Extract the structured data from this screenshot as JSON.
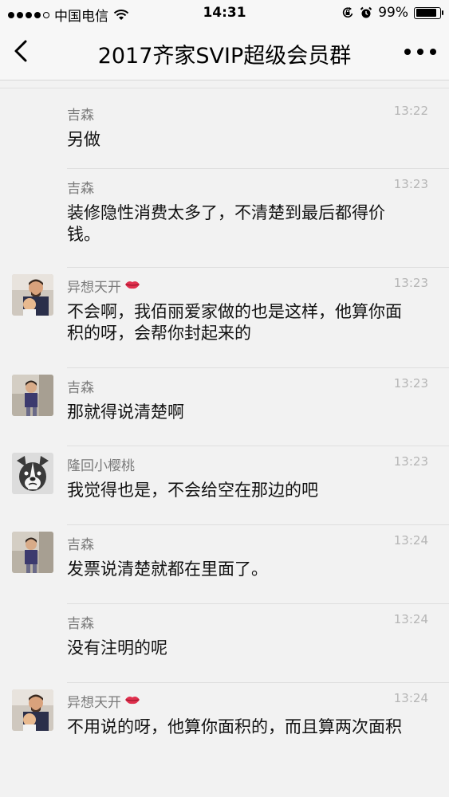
{
  "status_bar": {
    "carrier": "中国电信",
    "time": "14:31",
    "battery": "99%",
    "battery_level": 0.99
  },
  "nav": {
    "title": "2017齐家SVIP超级会员群"
  },
  "messages": [
    {
      "sender": "吉森",
      "time": "13:22",
      "text": "另做",
      "avatar": "none",
      "heart": false
    },
    {
      "sender": "吉森",
      "time": "13:23",
      "text": "装修隐性消费太多了，不清楚到最后都得价钱。",
      "avatar": "none",
      "heart": false
    },
    {
      "sender": "异想天开",
      "time": "13:23",
      "text": "不会啊，我佰丽爱家做的也是这样，他算你面积的呀，会帮你封起来的",
      "avatar": "man-with-baby",
      "heart": true
    },
    {
      "sender": "吉森",
      "time": "13:23",
      "text": "那就得说清楚啊",
      "avatar": "child-photo",
      "heart": false
    },
    {
      "sender": "隆回小樱桃",
      "time": "13:23",
      "text": "我觉得也是，不会给空在那边的吧",
      "avatar": "dog-cartoon",
      "heart": false
    },
    {
      "sender": "吉森",
      "time": "13:24",
      "text": "发票说清楚就都在里面了。",
      "avatar": "child-photo",
      "heart": false
    },
    {
      "sender": "吉森",
      "time": "13:24",
      "text": "没有注明的呢",
      "avatar": "none",
      "heart": false
    },
    {
      "sender": "异想天开",
      "time": "13:24",
      "text": "不用说的呀，他算你面积的，而且算两次面积",
      "avatar": "man-with-baby",
      "heart": true
    }
  ]
}
